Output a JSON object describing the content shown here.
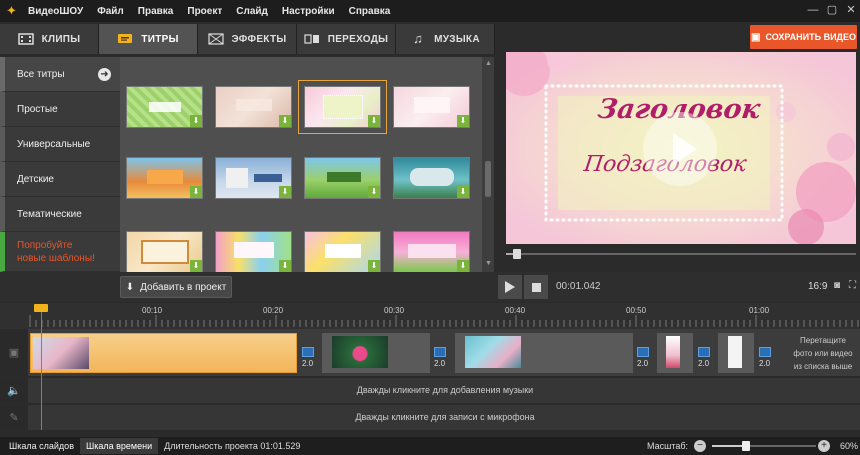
{
  "menu": {
    "app": "ВидеоШОУ",
    "items": [
      "Файл",
      "Правка",
      "Проект",
      "Слайд",
      "Настройки",
      "Справка"
    ]
  },
  "tabs": [
    {
      "label": "КЛИПЫ",
      "icon": "film-icon"
    },
    {
      "label": "ТИТРЫ",
      "icon": "titles-icon",
      "active": true
    },
    {
      "label": "ЭФФЕКТЫ",
      "icon": "effects-icon"
    },
    {
      "label": "ПЕРЕХОДЫ",
      "icon": "transitions-icon"
    },
    {
      "label": "МУЗЫКА",
      "icon": "music-icon"
    }
  ],
  "save_button": "СОХРАНИТЬ ВИДЕО",
  "categories": {
    "all": "Все титры",
    "items": [
      "Простые",
      "Универсальные",
      "Детские",
      "Тематические"
    ],
    "promo_line1": "Попробуйте",
    "promo_line2": "новые шаблоны!"
  },
  "preview": {
    "title": "Заголовок",
    "subtitle": "Подзаголовок",
    "progress": 0.02
  },
  "add_to_project": "Добавить в проект",
  "playback": {
    "time": "00:01.042",
    "aspect": "16:9"
  },
  "ruler_ticks": [
    "00:10",
    "00:20",
    "00:30",
    "00:40",
    "00:50",
    "01:00"
  ],
  "transitions": [
    "2.0",
    "2.0",
    "2.0",
    "2.0",
    "2.0"
  ],
  "drop_hint": "Перетащите фото или видео из списка выше",
  "music_hint": "Дважды кликните для добавления музыки",
  "mic_hint": "Дважды кликните для записи с микрофона",
  "status": {
    "slides_tab": "Шкала слайдов",
    "timeline_tab": "Шкала времени",
    "duration": "Длительность проекта 01:01.529",
    "scale_label": "Масштаб:",
    "zoom": "60%",
    "zoom_value": 0.6
  },
  "colors": {
    "accent": "#e8562a",
    "selection": "#f2b84a",
    "download_badge": "#7ab43a",
    "transition": "#2a6fb5",
    "promo_bar": "#4aa841"
  }
}
